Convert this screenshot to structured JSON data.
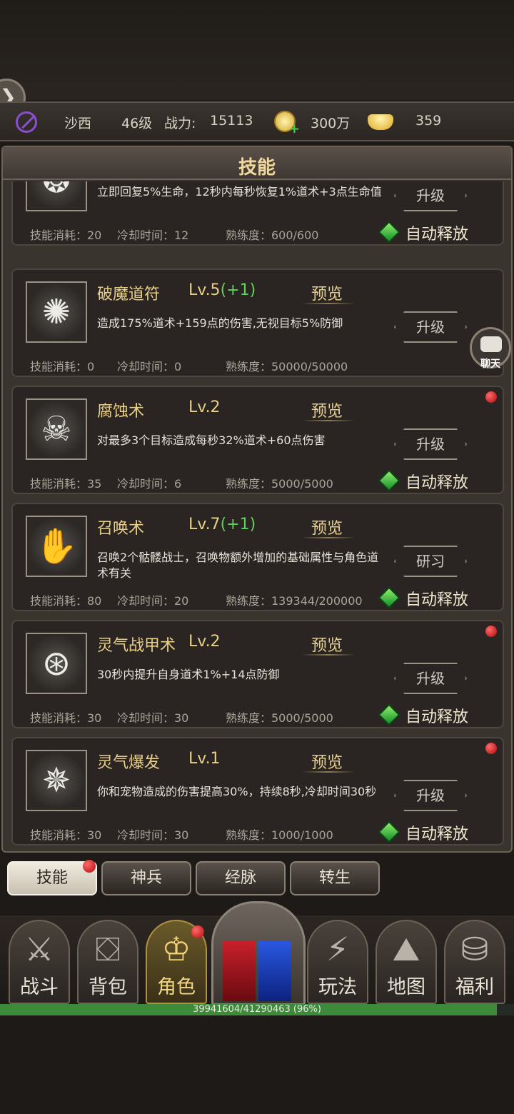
{
  "status": {
    "name": "沙西",
    "level": "46级",
    "power_label": "战力:",
    "power_value": "15113",
    "coins": "300万",
    "ingots": "359"
  },
  "panel": {
    "title": "技能"
  },
  "skills": [
    {
      "icon": "tornado-spirit-icon",
      "name": "",
      "level": "",
      "plus": "",
      "preview": "",
      "desc": "立即回复5%生命，12秒内每秒恢复1%道术+3点生命值",
      "cost": "技能消耗：20",
      "cooldown": "冷却时间：12",
      "mastery": "熟练度：600/600",
      "action": "升级",
      "auto": "自动释放",
      "has_auto": true,
      "alert": false
    },
    {
      "icon": "vortex-seal-icon",
      "name": "破魔道符",
      "level": "Lv.5",
      "plus": "(+1)",
      "preview": "预览",
      "desc": "造成175%道术+159点的伤害,无视目标5%防御",
      "cost": "技能消耗：0",
      "cooldown": "冷却时间：0",
      "mastery": "熟练度：50000/50000",
      "action": "升级",
      "auto": "",
      "has_auto": false,
      "alert": false
    },
    {
      "icon": "ghost-skulls-icon",
      "name": "腐蚀术",
      "level": "Lv.2",
      "plus": "",
      "preview": "预览",
      "desc": "对最多3个目标造成每秒32%道术+60点伤害",
      "cost": "技能消耗：35",
      "cooldown": "冷却时间：6",
      "mastery": "熟练度：5000/5000",
      "action": "升级",
      "auto": "自动释放",
      "has_auto": true,
      "alert": true
    },
    {
      "icon": "summon-hand-icon",
      "name": "召唤术",
      "level": "Lv.7",
      "plus": "(+1)",
      "preview": "预览",
      "desc": "召唤2个骷髅战士，召唤物额外增加的基础属性与角色道术有关",
      "cost": "技能消耗：80",
      "cooldown": "冷却时间：20",
      "mastery": "熟练度：139344/200000",
      "action": "研习",
      "auto": "自动释放",
      "has_auto": true,
      "alert": false
    },
    {
      "icon": "rune-armor-icon",
      "name": "灵气战甲术",
      "level": "Lv.2",
      "plus": "",
      "preview": "预览",
      "desc": "30秒内提升自身道术1%+14点防御",
      "cost": "技能消耗：30",
      "cooldown": "冷却时间：30",
      "mastery": "熟练度：5000/5000",
      "action": "升级",
      "auto": "自动释放",
      "has_auto": true,
      "alert": true
    },
    {
      "icon": "spirit-burst-icon",
      "name": "灵气爆发",
      "level": "Lv.1",
      "plus": "",
      "preview": "预览",
      "desc": "你和宠物造成的伤害提高30%，持续8秒,冷却时间30秒",
      "cost": "技能消耗：30",
      "cooldown": "冷却时间：30",
      "mastery": "熟练度：1000/1000",
      "action": "升级",
      "auto": "自动释放",
      "has_auto": true,
      "alert": true
    }
  ],
  "chat": {
    "label": "聊天"
  },
  "tabs": [
    "技能",
    "神兵",
    "经脉",
    "转生"
  ],
  "nav": [
    "战斗",
    "背包",
    "角色",
    "玩法",
    "地图",
    "福利"
  ],
  "exp": {
    "text": "39941604/41290463 (96%)",
    "fraction": 0.967
  },
  "colors": {
    "gold_text": "#e8cf88",
    "bonus_green": "#5ed35a",
    "exp_green": "#3c8a3a",
    "alert_red": "#b00808"
  }
}
